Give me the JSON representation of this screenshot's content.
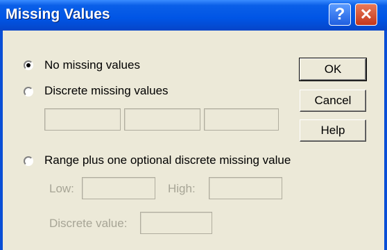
{
  "window": {
    "title": "Missing Values",
    "help_glyph": "?",
    "close_glyph": "✕"
  },
  "options": {
    "no_missing": "No missing values",
    "discrete": "Discrete missing values",
    "range": "Range plus one optional discrete missing value",
    "selected": "no_missing"
  },
  "range_fields": {
    "low_label": "Low:",
    "high_label": "High:",
    "discrete_label": "Discrete value:"
  },
  "buttons": {
    "ok": "OK",
    "cancel": "Cancel",
    "help": "Help"
  }
}
